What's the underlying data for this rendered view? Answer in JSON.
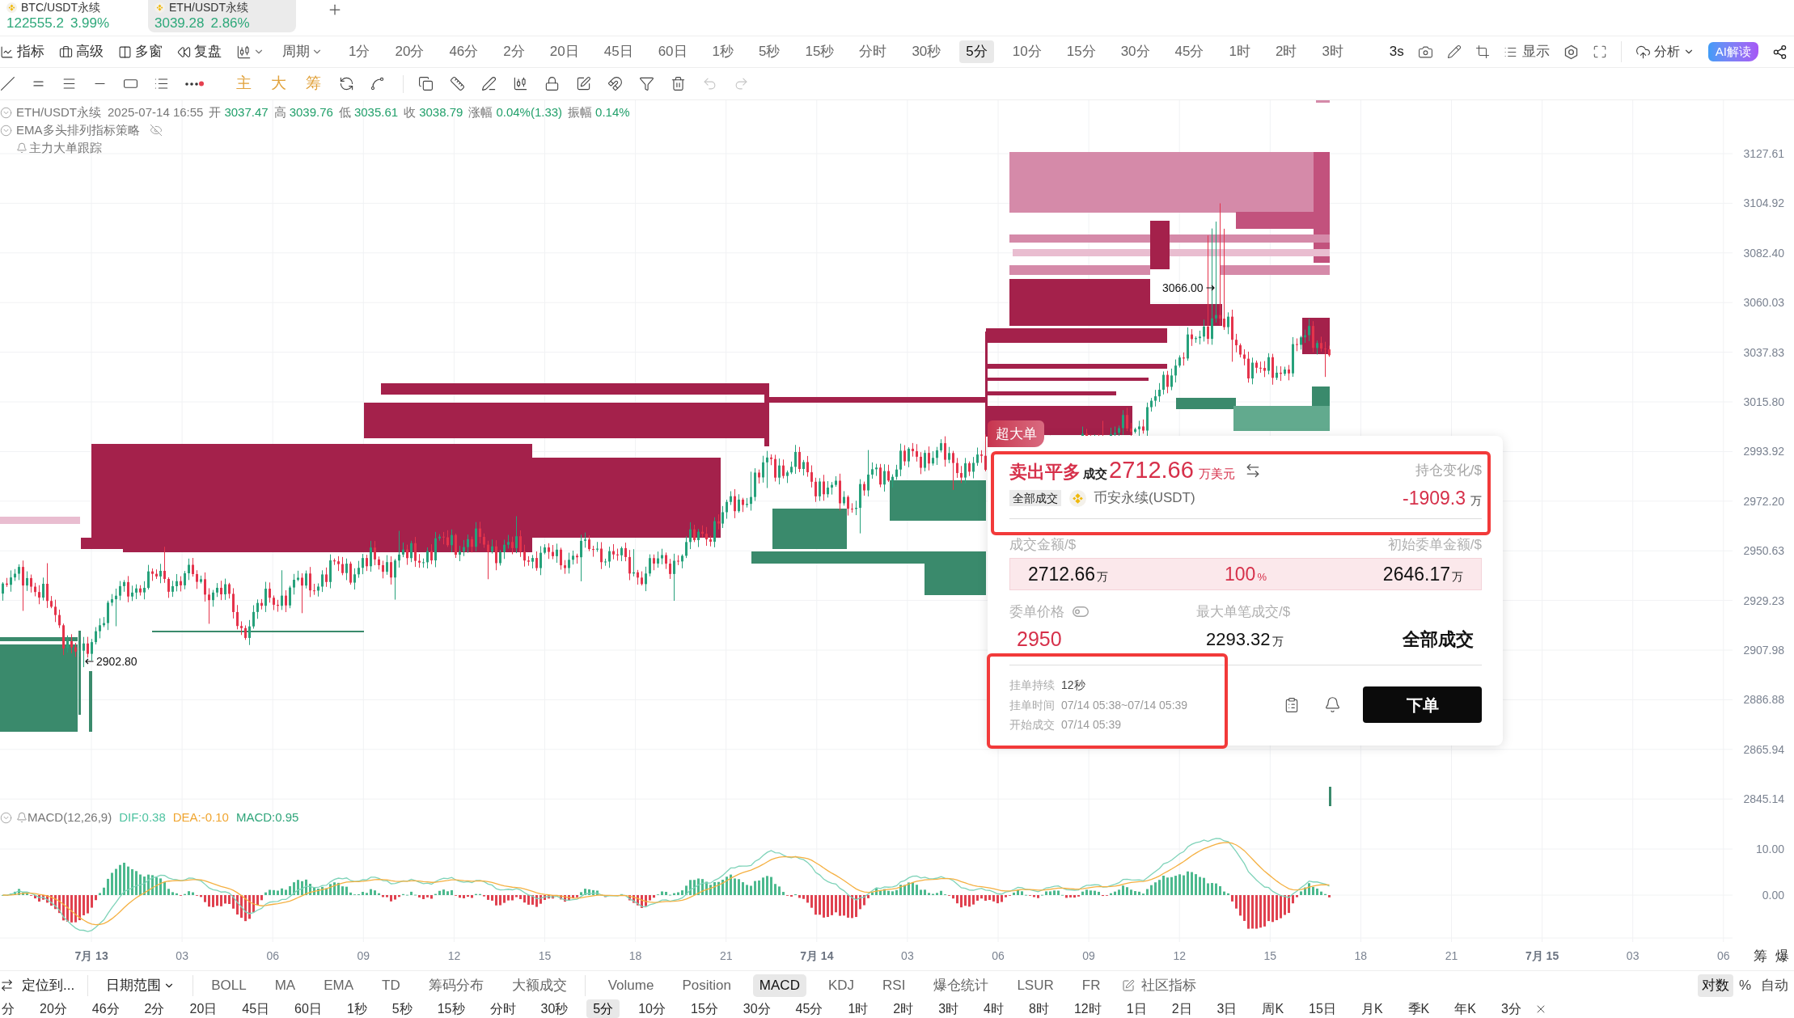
{
  "market_tabs": [
    {
      "symbol": "BTC/USDT永续",
      "price": "122555.2",
      "change": "3.99%",
      "selected": false
    },
    {
      "symbol": "ETH/USDT永续",
      "price": "3039.28",
      "change": "2.86%",
      "selected": true
    }
  ],
  "toolbar": {
    "tools": [
      "指标",
      "高级",
      "多窗",
      "复盘"
    ],
    "period": "周期",
    "intervals": [
      {
        "label": "1分",
        "selected": false
      },
      {
        "label": "20分",
        "selected": false
      },
      {
        "label": "46分",
        "selected": false
      },
      {
        "label": "2分",
        "selected": false
      },
      {
        "label": "20日",
        "selected": false
      },
      {
        "label": "45日",
        "selected": false
      },
      {
        "label": "60日",
        "selected": false
      },
      {
        "label": "1秒",
        "selected": false
      },
      {
        "label": "5秒",
        "selected": false
      },
      {
        "label": "15秒",
        "selected": false
      },
      {
        "label": "分时",
        "selected": false
      },
      {
        "label": "30秒",
        "selected": false
      },
      {
        "label": "5分",
        "selected": true
      },
      {
        "label": "10分",
        "selected": false
      },
      {
        "label": "15分",
        "selected": false
      },
      {
        "label": "30分",
        "selected": false
      },
      {
        "label": "45分",
        "selected": false
      },
      {
        "label": "1时",
        "selected": false
      },
      {
        "label": "2时",
        "selected": false
      },
      {
        "label": "3时",
        "selected": false
      }
    ],
    "refresh": "3s",
    "display": "显示",
    "analysis": "分析",
    "ai": "AI解读"
  },
  "drawing_toolbar": {
    "overlays": [
      "主",
      "大",
      "筹"
    ]
  },
  "chart": {
    "legend": {
      "symbol": "ETH/USDT永续",
      "time": "2025-07-14 16:55",
      "fields": [
        {
          "label": "开",
          "value": "3037.47"
        },
        {
          "label": "高",
          "value": "3039.76"
        },
        {
          "label": "低",
          "value": "3035.61"
        },
        {
          "label": "收",
          "value": "3038.79"
        },
        {
          "label": "涨幅",
          "value": "0.04%(1.33)"
        },
        {
          "label": "振幅",
          "value": "0.14%"
        }
      ]
    },
    "studies": [
      {
        "kind": "strategy",
        "label": "EMA多头排列指标策略"
      },
      {
        "kind": "tracker",
        "label": "主力大单跟踪"
      }
    ],
    "price_labels": [
      "3127.61",
      "3104.92",
      "3082.40",
      "3060.03",
      "3037.83",
      "3015.80",
      "2993.92",
      "2972.20",
      "2950.63",
      "2929.23",
      "2907.98",
      "2886.88",
      "2865.94",
      "2845.14"
    ],
    "markers": [
      {
        "kind": "low",
        "text": "2902.80"
      },
      {
        "kind": "high",
        "text": "3066.00"
      }
    ]
  },
  "order_popup": {
    "badge": "超大单",
    "action": "卖出平多",
    "action_status": "成交",
    "amount": "2712.66",
    "amount_unit": "万美元",
    "position_change_label": "持仓变化/$",
    "position_change": "-1909.3",
    "position_change_unit": "万",
    "status_tag": "全部成交",
    "exchange": "币安永续(USDT)",
    "filled_label": "成交金额/$",
    "initial_label": "初始委单金额/$",
    "fill": {
      "filled": "2712.66",
      "filled_unit": "万",
      "ratio": "100",
      "ratio_unit": "%",
      "initial": "2646.17",
      "initial_unit": "万",
      "level": 1
    },
    "price_label": "委单价格",
    "max_fill_label": "最大单笔成交/$",
    "price": "2950",
    "max_fill": "2293.32",
    "max_fill_unit": "万",
    "status": "全部成交",
    "details": [
      {
        "label": "挂单持续",
        "value": "12秒"
      },
      {
        "label": "挂单时间",
        "value": "07/14 05:38~07/14 05:39"
      },
      {
        "label": "开始成交",
        "value": "07/14 05:39"
      }
    ],
    "order_button": "下单"
  },
  "macd": {
    "title": "MACD(12,26,9)",
    "values": [
      {
        "kind": "dif",
        "text": "DIF:0.38"
      },
      {
        "kind": "dea",
        "text": "DEA:-0.10"
      },
      {
        "kind": "macd",
        "text": "MACD:0.95"
      }
    ],
    "axis_labels": [
      "10.00",
      "0.00"
    ]
  },
  "time_axis": [
    {
      "kind": "date",
      "label": "7月 13"
    },
    {
      "kind": "hour",
      "label": "03"
    },
    {
      "kind": "hour",
      "label": "06"
    },
    {
      "kind": "hour",
      "label": "09"
    },
    {
      "kind": "hour",
      "label": "12"
    },
    {
      "kind": "hour",
      "label": "15"
    },
    {
      "kind": "hour",
      "label": "18"
    },
    {
      "kind": "hour",
      "label": "21"
    },
    {
      "kind": "date",
      "label": "7月 14"
    },
    {
      "kind": "hour",
      "label": "03"
    },
    {
      "kind": "hour",
      "label": "06"
    },
    {
      "kind": "hour",
      "label": "09"
    },
    {
      "kind": "hour",
      "label": "12"
    },
    {
      "kind": "hour",
      "label": "15"
    },
    {
      "kind": "hour",
      "label": "18"
    },
    {
      "kind": "hour",
      "label": "21"
    },
    {
      "kind": "date",
      "label": "7月 15"
    },
    {
      "kind": "hour",
      "label": "03"
    },
    {
      "kind": "hour",
      "label": "06"
    }
  ],
  "axis_buttons": [
    "筹",
    "爆"
  ],
  "bottom_bar": {
    "locate": "定位到...",
    "date_range": "日期范围",
    "overlays": [
      "BOLL",
      "MA",
      "EMA",
      "TD",
      "筹码分布",
      "大额成交"
    ],
    "indicators": [
      {
        "label": "Volume",
        "selected": false
      },
      {
        "label": "Position",
        "selected": false
      },
      {
        "label": "MACD",
        "selected": true
      },
      {
        "label": "KDJ",
        "selected": false
      },
      {
        "label": "RSI",
        "selected": false
      },
      {
        "label": "爆仓统计",
        "selected": false
      },
      {
        "label": "LSUR",
        "selected": false
      },
      {
        "label": "FR",
        "selected": false
      }
    ],
    "community": "社区指标",
    "scales": [
      {
        "label": "对数",
        "selected": true
      },
      {
        "label": "%",
        "selected": false
      },
      {
        "label": "自动",
        "selected": false
      }
    ]
  },
  "interval_bar": [
    {
      "label": "分",
      "selected": false
    },
    {
      "label": "20分",
      "selected": false
    },
    {
      "label": "46分",
      "selected": false
    },
    {
      "label": "2分",
      "selected": false
    },
    {
      "label": "20日",
      "selected": false
    },
    {
      "label": "45日",
      "selected": false
    },
    {
      "label": "60日",
      "selected": false
    },
    {
      "label": "1秒",
      "selected": false
    },
    {
      "label": "5秒",
      "selected": false
    },
    {
      "label": "15秒",
      "selected": false
    },
    {
      "label": "分时",
      "selected": false
    },
    {
      "label": "30秒",
      "selected": false
    },
    {
      "label": "5分",
      "selected": true
    },
    {
      "label": "10分",
      "selected": false
    },
    {
      "label": "15分",
      "selected": false
    },
    {
      "label": "30分",
      "selected": false
    },
    {
      "label": "45分",
      "selected": false
    },
    {
      "label": "1时",
      "selected": false
    },
    {
      "label": "2时",
      "selected": false
    },
    {
      "label": "3时",
      "selected": false
    },
    {
      "label": "4时",
      "selected": false
    },
    {
      "label": "8时",
      "selected": false
    },
    {
      "label": "12时",
      "selected": false
    },
    {
      "label": "1日",
      "selected": false
    },
    {
      "label": "2日",
      "selected": false
    },
    {
      "label": "3日",
      "selected": false
    },
    {
      "label": "周K",
      "selected": false
    },
    {
      "label": "15日",
      "selected": false
    },
    {
      "label": "月K",
      "selected": false
    },
    {
      "label": "季K",
      "selected": false
    },
    {
      "label": "年K",
      "selected": false
    },
    {
      "label": "3分",
      "selected": false
    }
  ]
}
